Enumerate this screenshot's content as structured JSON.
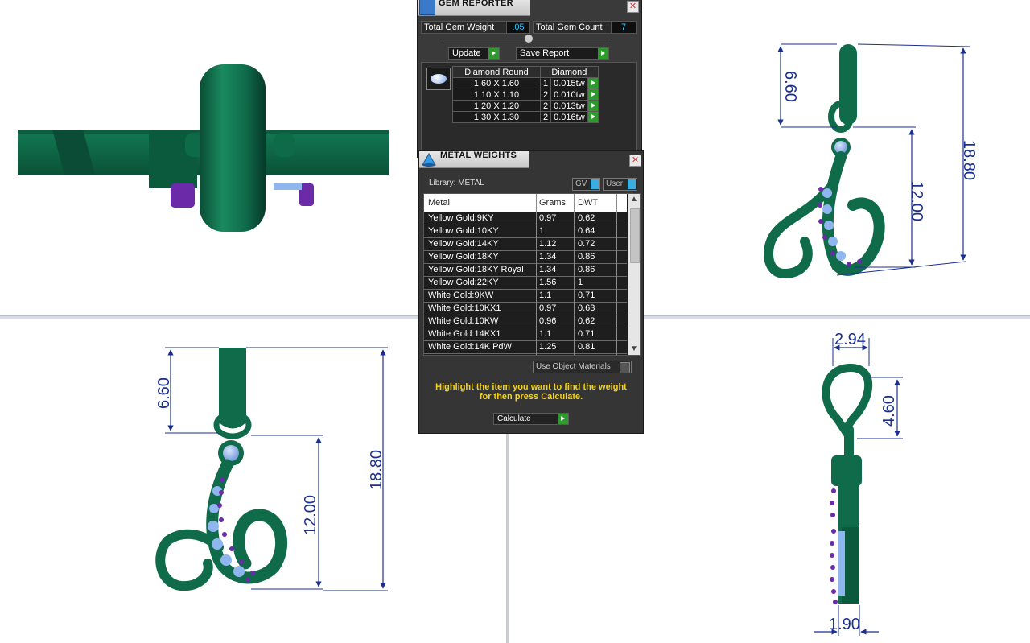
{
  "gem_reporter": {
    "title": "GEM REPORTER",
    "total_weight_label": "Total Gem Weight",
    "total_weight_value": ".05",
    "total_count_label": "Total Gem Count",
    "total_count_value": "7",
    "update_label": "Update",
    "save_report_label": "Save Report",
    "table": {
      "col_shape": "Diamond Round",
      "col_material": "Diamond",
      "rows": [
        {
          "size": "1.60 X 1.60",
          "count": "1",
          "weight": "0.015tw"
        },
        {
          "size": "1.10 X 1.10",
          "count": "2",
          "weight": "0.010tw"
        },
        {
          "size": "1.20 X 1.20",
          "count": "2",
          "weight": "0.013tw"
        },
        {
          "size": "1.30 X 1.30",
          "count": "2",
          "weight": "0.016tw"
        }
      ]
    }
  },
  "metal_weights": {
    "title": "METAL WEIGHTS",
    "library_label": "Library: METAL",
    "gv_label": "GV",
    "user_label": "User",
    "columns": {
      "metal": "Metal",
      "grams": "Grams",
      "dwt": "DWT"
    },
    "rows": [
      {
        "metal": "Yellow Gold:9KY",
        "grams": "0.97",
        "dwt": "0.62"
      },
      {
        "metal": "Yellow Gold:10KY",
        "grams": "1",
        "dwt": "0.64"
      },
      {
        "metal": "Yellow Gold:14KY",
        "grams": "1.12",
        "dwt": "0.72"
      },
      {
        "metal": "Yellow Gold:18KY",
        "grams": "1.34",
        "dwt": "0.86"
      },
      {
        "metal": "Yellow Gold:18KY Royal",
        "grams": "1.34",
        "dwt": "0.86"
      },
      {
        "metal": "Yellow Gold:22KY",
        "grams": "1.56",
        "dwt": "1"
      },
      {
        "metal": "White Gold:9KW",
        "grams": "1.1",
        "dwt": "0.71"
      },
      {
        "metal": "White Gold:10KX1",
        "grams": "0.97",
        "dwt": "0.63"
      },
      {
        "metal": "White Gold:10KW",
        "grams": "0.96",
        "dwt": "0.62"
      },
      {
        "metal": "White Gold:14KX1",
        "grams": "1.1",
        "dwt": "0.71"
      },
      {
        "metal": "White Gold:14K PdW",
        "grams": "1.25",
        "dwt": "0.81"
      }
    ],
    "use_object_materials_label": "Use Object Materials",
    "instruction": "Highlight the item you want to find the weight for then press Calculate.",
    "calculate_label": "Calculate"
  },
  "dimensions": {
    "top_right_bail": "6.60",
    "top_right_body": "12.00",
    "top_right_total": "18.80",
    "bottom_left_bail": "6.60",
    "bottom_left_body": "12.00",
    "bottom_left_total": "18.80",
    "side_width_top": "2.94",
    "side_bail_height": "4.60",
    "side_thickness": "1.90"
  },
  "colors": {
    "metal_green": "#0f6b4a",
    "gem_blue": "#8fb6ee",
    "prong_purple": "#6b2aa8",
    "dim_blue": "#1b2f8f",
    "instruction_yellow": "#f2d21a"
  }
}
